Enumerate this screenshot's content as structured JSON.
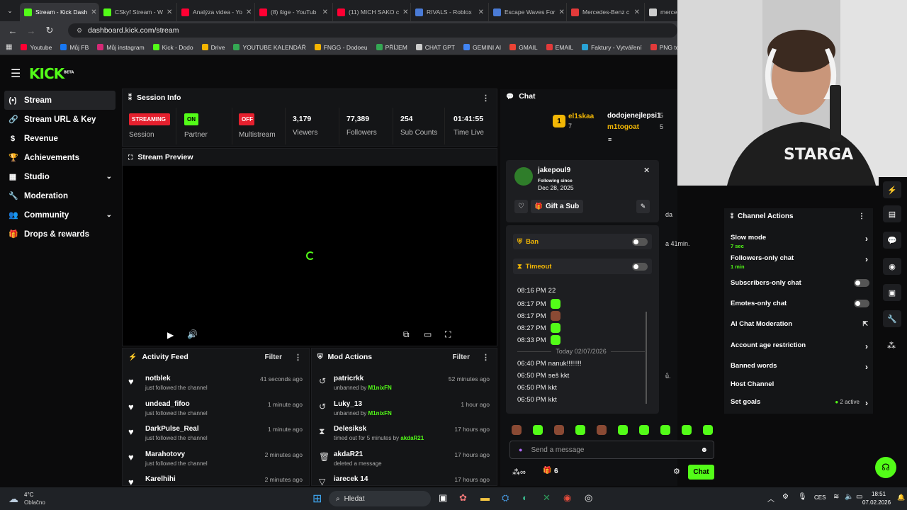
{
  "browser": {
    "tabs": [
      {
        "title": "Stream - Kick Dash",
        "color": "#53fc18",
        "active": true
      },
      {
        "title": "CSkyf Stream - W",
        "color": "#53fc18"
      },
      {
        "title": "Analýza videa - Yo",
        "color": "#ff0033"
      },
      {
        "title": "(8) šige - YouTub",
        "color": "#ff0033"
      },
      {
        "title": "(11) MICH SAKO c",
        "color": "#ff0033"
      },
      {
        "title": "RIVALS - Roblox",
        "color": "#4a7bd6"
      },
      {
        "title": "Escape Waves For",
        "color": "#4a7bd6"
      },
      {
        "title": "Mercedes-Benz c",
        "color": "#e23a3a"
      },
      {
        "title": "merce",
        "color": "#cccccc"
      }
    ],
    "url": "dashboard.kick.com/stream",
    "bookmarks": [
      {
        "label": "Youtube",
        "color": "#ff0033"
      },
      {
        "label": "Můj FB",
        "color": "#1877f2"
      },
      {
        "label": "Můj instagram",
        "color": "#d62976"
      },
      {
        "label": "Kick - Dodo",
        "color": "#53fc18"
      },
      {
        "label": "Drive",
        "color": "#f4b400"
      },
      {
        "label": "YOUTUBE KALENDÁŘ",
        "color": "#34a853"
      },
      {
        "label": "FNGG - Dodoeu",
        "color": "#f4b400"
      },
      {
        "label": "PŘÍJEM",
        "color": "#34a853"
      },
      {
        "label": "CHAT GPT",
        "color": "#cccccc"
      },
      {
        "label": "GEMINI AI",
        "color": "#4285f4"
      },
      {
        "label": "GMAIL",
        "color": "#ea4335"
      },
      {
        "label": "EMAIL",
        "color": "#e23a3a"
      },
      {
        "label": "Faktury - Vytváření",
        "color": "#29a3d6"
      },
      {
        "label": "PNG to PDF",
        "color": "#e23a3a"
      }
    ]
  },
  "kick": {
    "logo": "KICK",
    "logo_beta": "BETA",
    "accent": "#53fc18",
    "sidebar": [
      {
        "label": "Stream",
        "icon": "(•)"
      },
      {
        "label": "Stream URL & Key",
        "icon": "🔗"
      },
      {
        "label": "Revenue",
        "icon": "$"
      },
      {
        "label": "Achievements",
        "icon": "🏆"
      },
      {
        "label": "Studio",
        "icon": "▦"
      },
      {
        "label": "Moderation",
        "icon": "🔧"
      },
      {
        "label": "Community",
        "icon": "👥"
      },
      {
        "label": "Drops & rewards",
        "icon": "🎁"
      }
    ],
    "session": {
      "title": "Session Info",
      "streaming": "STREAMING",
      "session_label": "Session",
      "on": "ON",
      "partner_label": "Partner Income",
      "off": "OFF",
      "multistream_label": "Multistream",
      "viewers": "3,179",
      "viewers_label": "Viewers",
      "followers": "77,389",
      "followers_label": "Followers",
      "subs": "254",
      "subs_label": "Sub Counts",
      "time": "01:41:55",
      "time_label": "Time Live"
    },
    "preview": {
      "title": "Stream Preview"
    },
    "activity": {
      "title": "Activity Feed",
      "filter": "Filter",
      "items": [
        {
          "name": "notblek",
          "sub": "just followed the channel",
          "time": "41 seconds ago"
        },
        {
          "name": "undead_fifoo",
          "sub": "just followed the channel",
          "time": "1 minute ago"
        },
        {
          "name": "DarkPulse_Real",
          "sub": "just followed the channel",
          "time": "1 minute ago"
        },
        {
          "name": "Marahotovy",
          "sub": "just followed the channel",
          "time": "2 minutes ago"
        },
        {
          "name": "Karelhihi",
          "sub": "",
          "time": "2 minutes ago"
        }
      ]
    },
    "mod": {
      "title": "Mod Actions",
      "filter": "Filter",
      "items": [
        {
          "name": "patricrkk",
          "sub": "unbanned by",
          "by": "M1nixFN",
          "time": "52 minutes ago",
          "icon": "↺"
        },
        {
          "name": "Luky_13",
          "sub": "unbanned by",
          "by": "M1nixFN",
          "time": "1 hour ago",
          "icon": "↺"
        },
        {
          "name": "Delesiksk",
          "sub": "timed out for 5 minutes by",
          "by": "akdaR21",
          "time": "17 hours ago",
          "icon": "⧗"
        },
        {
          "name": "akdaR21",
          "sub": "deleted a message",
          "by": "",
          "time": "17 hours ago",
          "icon": "🗑"
        },
        {
          "name": "iarecek 14",
          "sub": "",
          "by": "",
          "time": "17 hours ago",
          "icon": "▽"
        }
      ]
    },
    "chat": {
      "title": "Chat",
      "top_user": "el1skaa",
      "top_user_count": "7",
      "top_rank": "1",
      "user2": "dodojenejlepsi1",
      "user2_count": "5",
      "user3": "m1togoat",
      "user3_count": "5",
      "popup_user": "jakepoul9",
      "following_since_label": "Following since",
      "following_since": "Dec 28, 2025",
      "gift_sub": "Gift a Sub",
      "ban": "Ban",
      "timeout": "Timeout",
      "lines": [
        {
          "time": "08:16 PM",
          "text": "22",
          "emote": ""
        },
        {
          "time": "08:17 PM",
          "text": "",
          "emote": "green"
        },
        {
          "time": "08:17 PM",
          "text": "",
          "emote": "brown"
        },
        {
          "time": "08:27 PM",
          "text": "",
          "emote": "green"
        },
        {
          "time": "08:33 PM",
          "text": "",
          "emote": "green"
        }
      ],
      "day_separator": "Today 02/07/2026",
      "lines2": [
        {
          "time": "06:40 PM",
          "text": "nanuk!!!!!!!!"
        },
        {
          "time": "06:50 PM",
          "text": "seš kkt"
        },
        {
          "time": "06:50 PM",
          "text": "kkt"
        },
        {
          "time": "06:50 PM",
          "text": "kkt"
        }
      ],
      "side_fragments": [
        "da",
        "a 41min.",
        "ů."
      ],
      "placeholder": "Send a message",
      "gift_count": "6",
      "send": "Chat"
    },
    "channel_actions": {
      "title": "Channel Actions",
      "slow_mode": "Slow mode",
      "slow_val": "7 sec",
      "followers_only": "Followers-only chat",
      "followers_val": "1 min",
      "subs_only": "Subscribers-only chat",
      "emotes_only": "Emotes-only chat",
      "ai_mod": "AI Chat Moderation",
      "age_restriction": "Account age restriction",
      "banned_words": "Banned words",
      "host": "Host Channel",
      "goals": "Set goals",
      "goals_val": "2 active"
    }
  },
  "taskbar": {
    "temp": "4°C",
    "weather": "Oblačno",
    "search": "Hledat",
    "lang": "CES",
    "time": "18:51",
    "date": "07.02.2026"
  }
}
